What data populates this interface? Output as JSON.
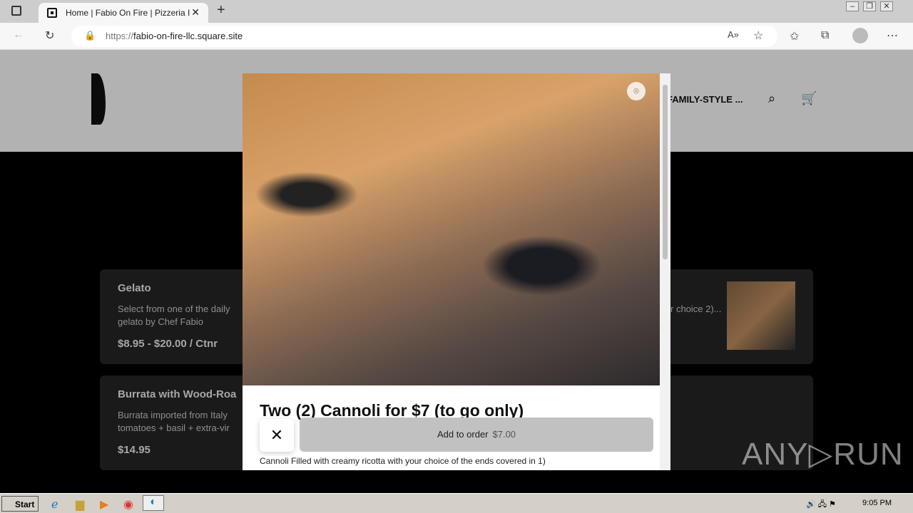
{
  "browser": {
    "tab_title": "Home | Fabio On Fire | Pizzeria I",
    "url_prefix": "https://",
    "url_host": "fabio-on-fire-llc.square.site"
  },
  "site": {
    "nav_item": "FAMILY-STYLE ..."
  },
  "menu_cards": [
    {
      "name": "Gelato",
      "description": "Select from one of the daily gelato by Chef Fabio",
      "price": "$8.95 - $20.00 / Ctnr"
    },
    {
      "name": "Burrata with Wood-Roa",
      "description": "Burrata imported from Italy tomatoes + basil + extra-vir",
      "price": "$14.95"
    },
    {
      "name": "",
      "description": "r choice 2)..."
    }
  ],
  "modal": {
    "title": "Two (2) Cannoli for $7 (to go only)",
    "description": "Cannoli Filled with creamy ricotta with your choice of the ends covered in 1)",
    "add_label": "Add to order",
    "add_price": "$7.00"
  },
  "taskbar": {
    "start": "Start",
    "clock": "9:05 PM"
  },
  "watermark": "ANY▷RUN"
}
